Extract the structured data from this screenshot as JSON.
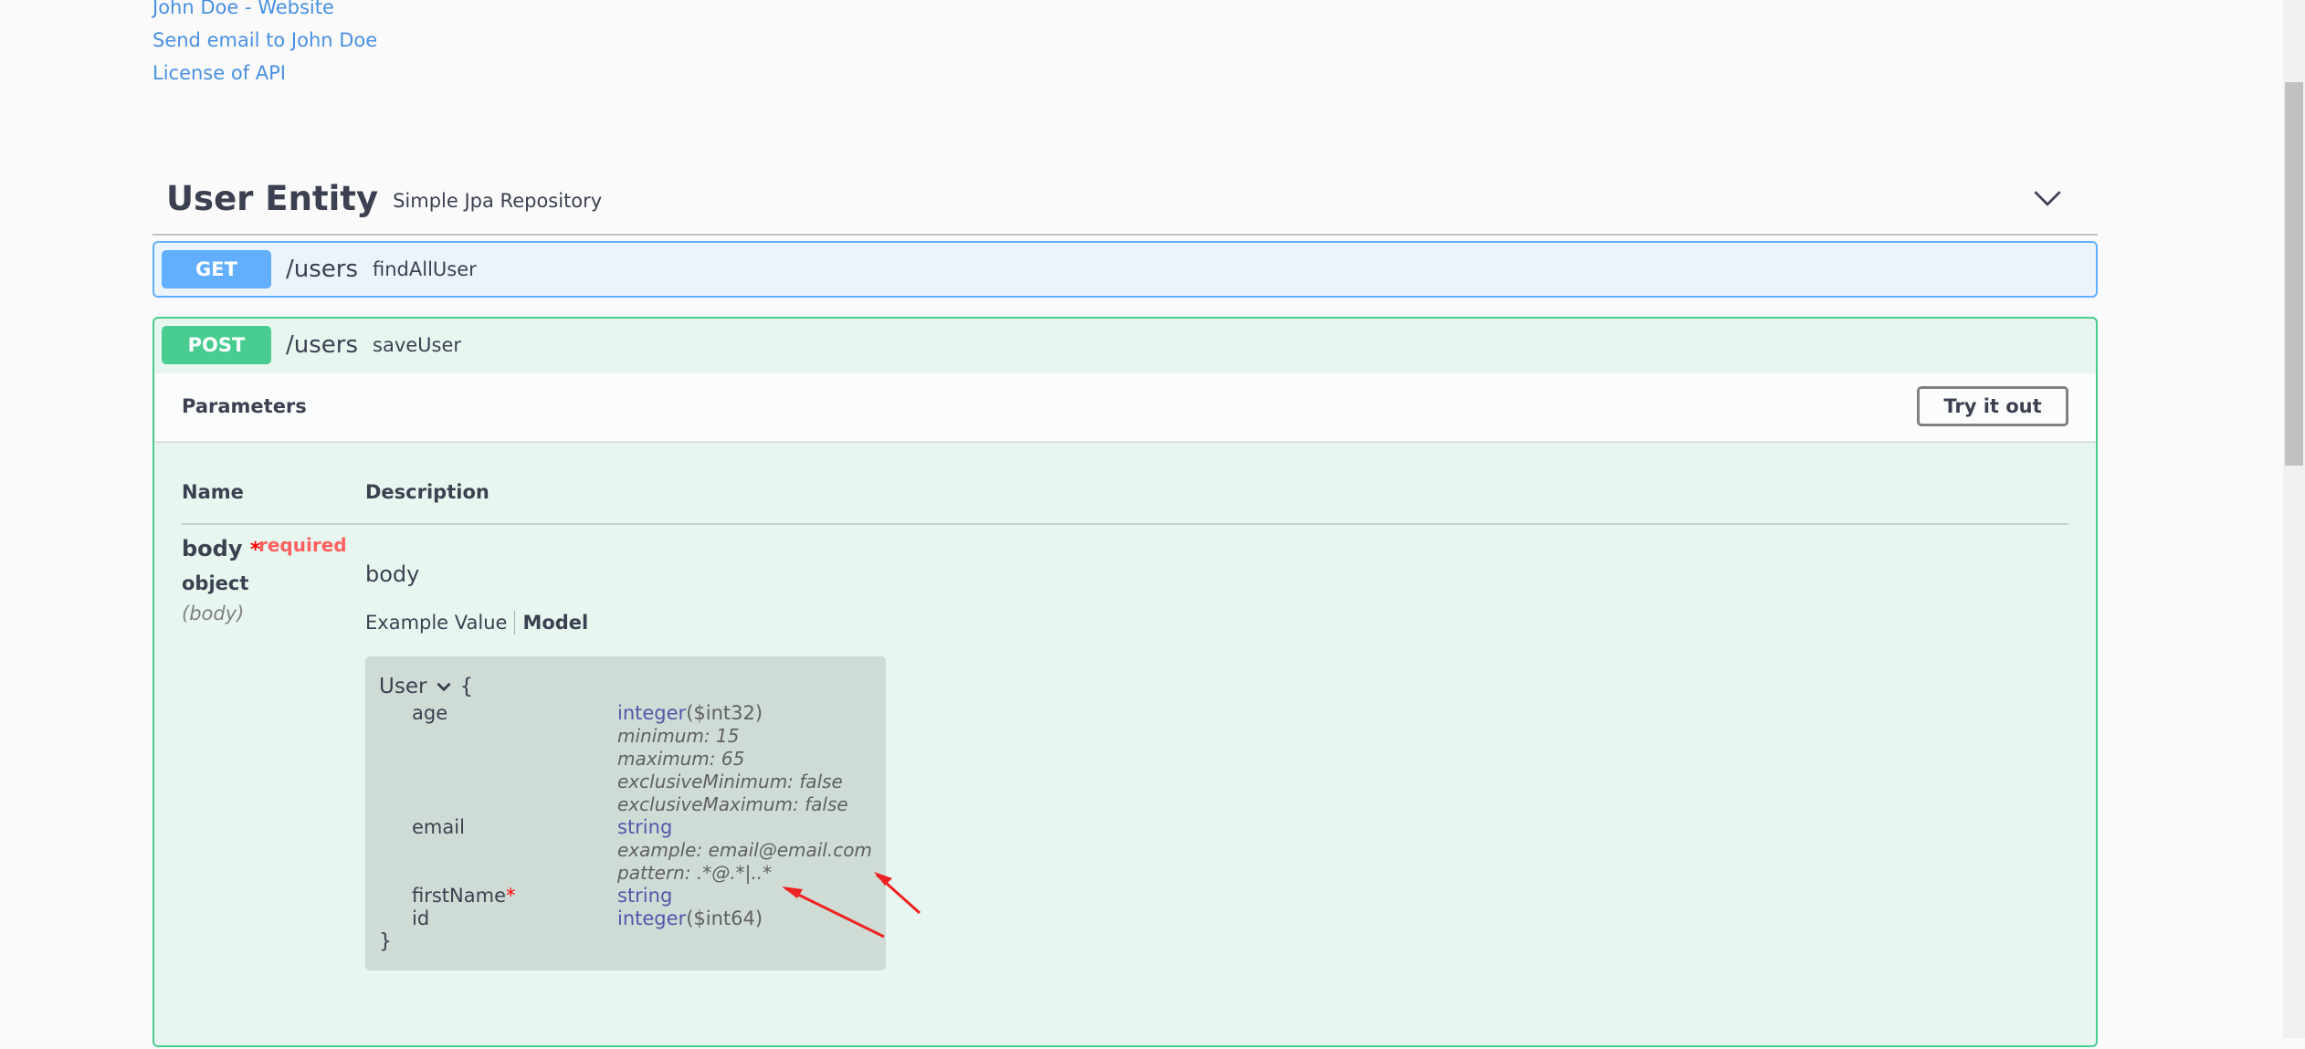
{
  "info": {
    "links": [
      {
        "label": "John Doe - Website"
      },
      {
        "label": "Send email to John Doe"
      },
      {
        "label": "License of API"
      }
    ]
  },
  "tag": {
    "title": "User Entity",
    "description": "Simple Jpa Repository",
    "chevron_icon": "chevron-down-icon"
  },
  "operations": {
    "get": {
      "method": "GET",
      "path": "/users",
      "operation_id": "findAllUser",
      "color": "#61affe"
    },
    "post": {
      "method": "POST",
      "path": "/users",
      "operation_id": "saveUser",
      "color": "#49cc90"
    }
  },
  "parameters": {
    "title": "Parameters",
    "try_button": "Try it out",
    "col_name": "Name",
    "col_description": "Description",
    "param": {
      "name": "body",
      "star": "*",
      "required": "required",
      "type": "object",
      "in": "(body)",
      "description": "body"
    },
    "tabs": {
      "example": "Example Value",
      "model": "Model"
    }
  },
  "model": {
    "name": "User",
    "open_brace": "{",
    "close_brace": "}",
    "properties": [
      {
        "name": "age",
        "type": "integer",
        "format": "($int32)",
        "meta": [
          "minimum: 15",
          "maximum: 65",
          "exclusiveMinimum: false",
          "exclusiveMaximum: false"
        ]
      },
      {
        "name": "email",
        "type": "string",
        "format": "",
        "meta": [
          "example: email@email.com",
          "pattern: .*@.*|..*"
        ]
      },
      {
        "name": "firstName",
        "required_star": "*",
        "type": "string",
        "format": "",
        "meta": []
      },
      {
        "name": "id",
        "type": "integer",
        "format": "($int64)",
        "meta": []
      }
    ]
  },
  "annotation_color": "#ee2222"
}
